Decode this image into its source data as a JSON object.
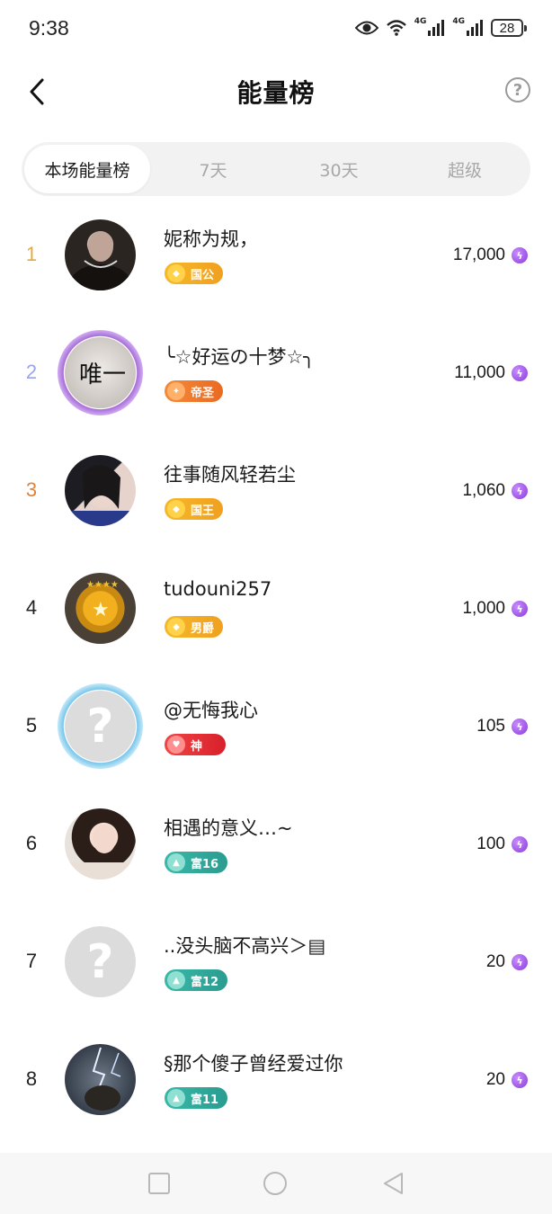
{
  "status_bar": {
    "time": "9:38",
    "net1": "4G",
    "net2": "4G",
    "battery": "28",
    "icons": [
      "eye-icon",
      "wifi-icon",
      "signal-icon",
      "signal-icon",
      "battery-icon"
    ]
  },
  "header": {
    "title": "能量榜",
    "back_icon": "chevron-left-icon",
    "help_label": "?"
  },
  "tabs": [
    {
      "label": "本场能量榜",
      "active": true
    },
    {
      "label": "7天",
      "active": false
    },
    {
      "label": "30天",
      "active": false
    },
    {
      "label": "超级",
      "active": false
    }
  ],
  "colors": {
    "rank1": "#e8a93a",
    "rank2": "#9aa6e8",
    "rank3": "#e0823a",
    "rank_default": "#222222",
    "badge_gold": "#f0a020",
    "badge_orange": "#f07a2a",
    "badge_red": "#e8323a",
    "badge_teal": "#2ea8a0",
    "energy": "#9b4be3"
  },
  "rankings": [
    {
      "rank": "1",
      "name": "妮称为规，",
      "badge": "国公",
      "badge_style": "gold",
      "score": "17,000"
    },
    {
      "rank": "2",
      "name": "╰☆好运の十梦☆╮",
      "badge": "帝圣",
      "badge_style": "orange",
      "score": "11,000"
    },
    {
      "rank": "3",
      "name": "往事随风轻若尘",
      "badge": "国王",
      "badge_style": "gold",
      "score": "1,060"
    },
    {
      "rank": "4",
      "name": "tudouni257",
      "badge": "男爵",
      "badge_style": "gold",
      "score": "1,000"
    },
    {
      "rank": "5",
      "name": "@无悔我心",
      "badge": "神",
      "badge_style": "red",
      "score": "105"
    },
    {
      "rank": "6",
      "name": "相遇的意义…~",
      "badge": "富16",
      "badge_style": "teal",
      "score": "100"
    },
    {
      "rank": "7",
      "name": "..没头脑不高兴＞▤",
      "badge": "富12",
      "badge_style": "teal",
      "score": "20"
    },
    {
      "rank": "8",
      "name": "§那个傻子曾经爱过你",
      "badge": "富11",
      "badge_style": "teal",
      "score": "20"
    }
  ],
  "nav_bar": {
    "buttons": [
      "square-recents-icon",
      "circle-home-icon",
      "triangle-back-icon"
    ]
  }
}
